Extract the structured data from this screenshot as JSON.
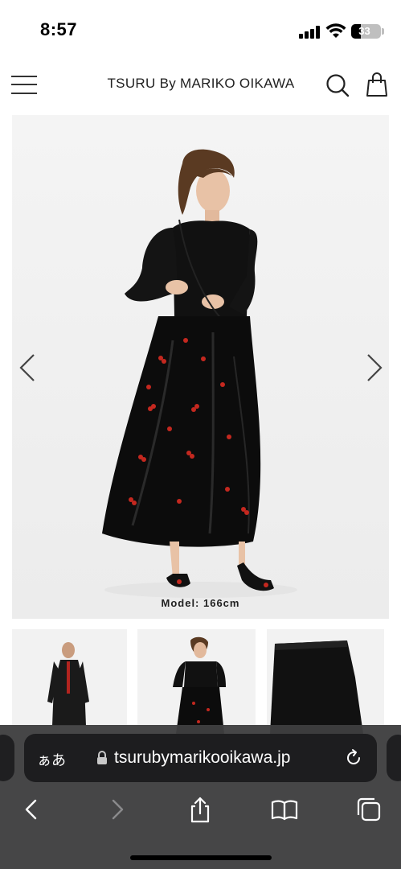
{
  "status_bar": {
    "time": "8:57",
    "battery": "33"
  },
  "header": {
    "brand": "TSURU By MARIKO OIKAWA",
    "icons": [
      "menu-icon",
      "search-icon",
      "shopping-bag-icon"
    ]
  },
  "product": {
    "model_caption": "Model: 166cm",
    "gallery_arrows": [
      "chevron-left-icon",
      "chevron-right-icon"
    ],
    "thumbnail_count": 3
  },
  "browser": {
    "aa_label": "ぁあ",
    "url": "tsurubymarikooikawa.jp",
    "toolbar_icons": [
      "back-icon",
      "forward-icon",
      "share-icon",
      "bookmarks-icon",
      "tabs-icon"
    ]
  },
  "colors": {
    "browser_bg": "#3e3e40",
    "url_field": "#1d1d1f",
    "text_dark": "#222222"
  }
}
